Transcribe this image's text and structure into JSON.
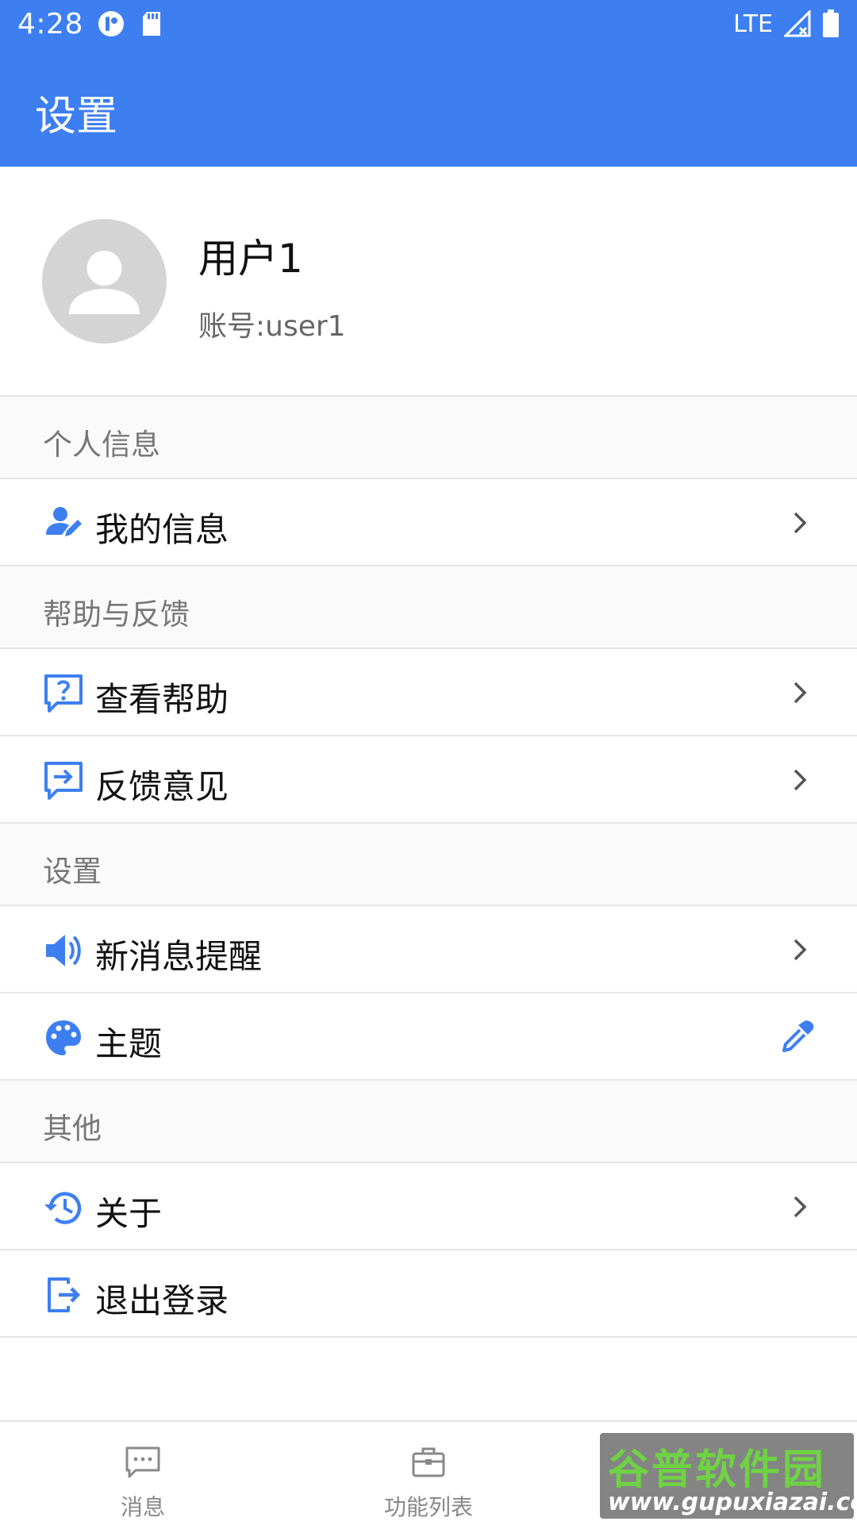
{
  "status_bar": {
    "time": "4:28",
    "network": "LTE"
  },
  "app_bar": {
    "title": "设置"
  },
  "profile": {
    "name": "用户1",
    "account": "账号:user1"
  },
  "sections": [
    {
      "header": "个人信息",
      "items": [
        {
          "label": "我的信息",
          "icon": "user-edit-icon",
          "trailing": "chevron-right-icon"
        }
      ]
    },
    {
      "header": "帮助与反馈",
      "items": [
        {
          "label": "查看帮助",
          "icon": "help-message-icon",
          "trailing": "chevron-right-icon"
        },
        {
          "label": "反馈意见",
          "icon": "feedback-message-icon",
          "trailing": "chevron-right-icon"
        }
      ]
    },
    {
      "header": "设置",
      "items": [
        {
          "label": "新消息提醒",
          "icon": "speaker-icon",
          "trailing": "chevron-right-icon"
        },
        {
          "label": "主题",
          "icon": "palette-icon",
          "trailing": "eyedropper-icon"
        }
      ]
    },
    {
      "header": "其他",
      "items": [
        {
          "label": "关于",
          "icon": "history-icon",
          "trailing": "chevron-right-icon"
        },
        {
          "label": "退出登录",
          "icon": "logout-icon",
          "trailing": ""
        }
      ]
    }
  ],
  "bottom_nav": [
    {
      "label": "消息",
      "icon": "chat-icon"
    },
    {
      "label": "功能列表",
      "icon": "briefcase-icon"
    }
  ],
  "watermark": {
    "main": "谷普软件园",
    "sub": "www.gupuxiazai.com"
  },
  "colors": {
    "primary": "#3d7ff1",
    "icon_blue": "#3d7ff1",
    "section_bg": "#fafafa"
  }
}
